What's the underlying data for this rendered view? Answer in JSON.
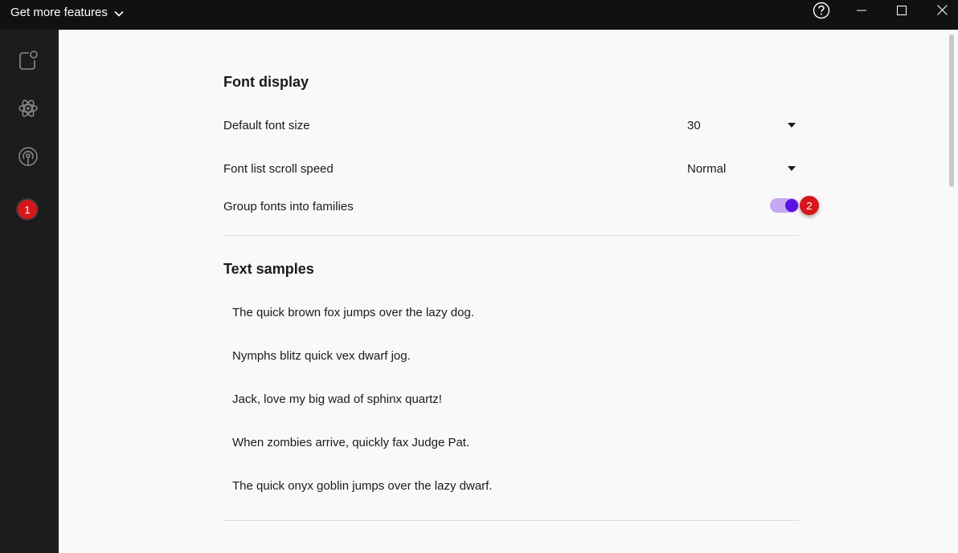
{
  "titlebar": {
    "menu_label": "Get more features"
  },
  "sidebar": {
    "items": [
      {
        "icon": "new-window-icon"
      },
      {
        "icon": "atom-icon"
      },
      {
        "icon": "broadcast-icon"
      }
    ],
    "badge": "1"
  },
  "font_display": {
    "title": "Font display",
    "default_font_size": {
      "label": "Default font size",
      "value": "30"
    },
    "scroll_speed": {
      "label": "Font list scroll speed",
      "value": "Normal"
    },
    "group_fonts": {
      "label": "Group fonts into families",
      "enabled": true
    },
    "badge": "2"
  },
  "text_samples": {
    "title": "Text samples",
    "items": [
      "The quick brown fox jumps over the lazy dog.",
      "Nymphs blitz quick vex dwarf jog.",
      "Jack, love my big wad of sphinx quartz!",
      "When zombies arrive, quickly fax Judge Pat.",
      "The quick onyx goblin jumps over the lazy dwarf."
    ]
  },
  "colors": {
    "toggle_track": "#c6a7f2",
    "toggle_knob": "#5a12e0",
    "badge": "#d6171b"
  }
}
